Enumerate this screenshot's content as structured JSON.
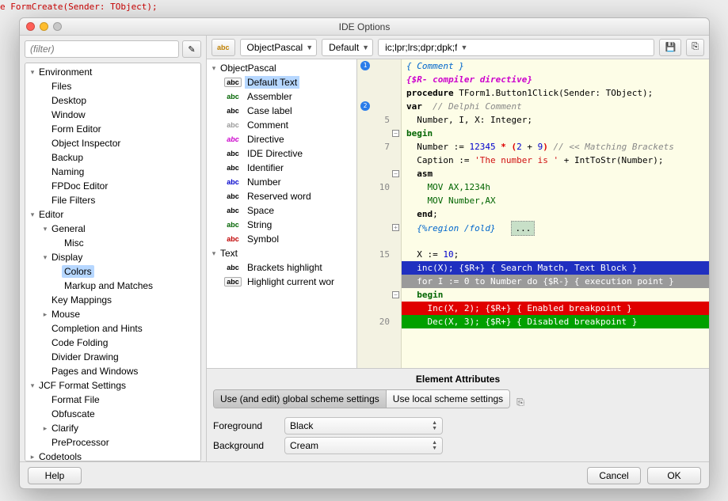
{
  "window": {
    "title": "IDE Options"
  },
  "filter": {
    "placeholder": "(filter)"
  },
  "nav": [
    {
      "label": "Environment",
      "depth": 1,
      "tw": "▾"
    },
    {
      "label": "Files",
      "depth": 2,
      "tw": ""
    },
    {
      "label": "Desktop",
      "depth": 2,
      "tw": ""
    },
    {
      "label": "Window",
      "depth": 2,
      "tw": ""
    },
    {
      "label": "Form Editor",
      "depth": 2,
      "tw": ""
    },
    {
      "label": "Object Inspector",
      "depth": 2,
      "tw": ""
    },
    {
      "label": "Backup",
      "depth": 2,
      "tw": ""
    },
    {
      "label": "Naming",
      "depth": 2,
      "tw": ""
    },
    {
      "label": "FPDoc Editor",
      "depth": 2,
      "tw": ""
    },
    {
      "label": "File Filters",
      "depth": 2,
      "tw": ""
    },
    {
      "label": "Editor",
      "depth": 1,
      "tw": "▾"
    },
    {
      "label": "General",
      "depth": 2,
      "tw": "▾"
    },
    {
      "label": "Misc",
      "depth": 3,
      "tw": ""
    },
    {
      "label": "Display",
      "depth": 2,
      "tw": "▾"
    },
    {
      "label": "Colors",
      "depth": 3,
      "tw": "",
      "sel": true
    },
    {
      "label": "Markup and Matches",
      "depth": 3,
      "tw": ""
    },
    {
      "label": "Key Mappings",
      "depth": 2,
      "tw": ""
    },
    {
      "label": "Mouse",
      "depth": 2,
      "tw": "▸"
    },
    {
      "label": "Completion and Hints",
      "depth": 2,
      "tw": ""
    },
    {
      "label": "Code Folding",
      "depth": 2,
      "tw": ""
    },
    {
      "label": "Divider Drawing",
      "depth": 2,
      "tw": ""
    },
    {
      "label": "Pages and Windows",
      "depth": 2,
      "tw": ""
    },
    {
      "label": "JCF Format Settings",
      "depth": 1,
      "tw": "▾"
    },
    {
      "label": "Format File",
      "depth": 2,
      "tw": ""
    },
    {
      "label": "Obfuscate",
      "depth": 2,
      "tw": ""
    },
    {
      "label": "Clarify",
      "depth": 2,
      "tw": "▸"
    },
    {
      "label": "PreProcessor",
      "depth": 2,
      "tw": ""
    },
    {
      "label": "Codetools",
      "depth": 1,
      "tw": "▸"
    }
  ],
  "toolbar": {
    "lang": "ObjectPascal",
    "scheme": "Default",
    "ext": "ic;lpr;lrs;dpr;dpk;f"
  },
  "elements": [
    {
      "label": "ObjectPascal",
      "depth": 0,
      "tw": "▾",
      "abc": null
    },
    {
      "label": "Default Text",
      "depth": 1,
      "abc": "abc",
      "abcColor": "#000",
      "box": true,
      "sel": true
    },
    {
      "label": "Assembler",
      "depth": 1,
      "abc": "abc",
      "abcColor": "#006400"
    },
    {
      "label": "Case label",
      "depth": 1,
      "abc": "abc",
      "abcColor": "#000"
    },
    {
      "label": "Comment",
      "depth": 1,
      "abc": "abc",
      "abcColor": "#999"
    },
    {
      "label": "Directive",
      "depth": 1,
      "abc": "abc",
      "abcColor": "#cc00cc",
      "italic": true
    },
    {
      "label": "IDE Directive",
      "depth": 1,
      "abc": "abc",
      "abcColor": "#000"
    },
    {
      "label": "Identifier",
      "depth": 1,
      "abc": "abc",
      "abcColor": "#000"
    },
    {
      "label": "Number",
      "depth": 1,
      "abc": "abc",
      "abcColor": "#0000cc"
    },
    {
      "label": "Reserved word",
      "depth": 1,
      "abc": "abc",
      "abcColor": "#000",
      "bold": true
    },
    {
      "label": "Space",
      "depth": 1,
      "abc": "abc",
      "abcColor": "#000"
    },
    {
      "label": "String",
      "depth": 1,
      "abc": "abc",
      "abcColor": "#006400"
    },
    {
      "label": "Symbol",
      "depth": 1,
      "abc": "abc",
      "abcColor": "#c00000"
    },
    {
      "label": "Text",
      "depth": 0,
      "tw": "▾",
      "abc": null
    },
    {
      "label": "Brackets highlight",
      "depth": 1,
      "abc": "abc",
      "abcColor": "#000",
      "bold": true
    },
    {
      "label": "Highlight current wor",
      "depth": 1,
      "abc": "abc",
      "abcColor": "#000",
      "box": true
    }
  ],
  "preview": {
    "gutter": [
      {
        "n": "",
        "bp": "1"
      },
      {
        "n": ""
      },
      {
        "n": ""
      },
      {
        "n": "",
        "bp": "2"
      },
      {
        "n": "5"
      },
      {
        "n": "",
        "fold": "−"
      },
      {
        "n": "7"
      },
      {
        "n": ""
      },
      {
        "n": "",
        "fold": "−"
      },
      {
        "n": "10"
      },
      {
        "n": ""
      },
      {
        "n": ""
      },
      {
        "n": "",
        "fold": "+"
      },
      {
        "n": ""
      },
      {
        "n": "15"
      },
      {
        "n": ""
      },
      {
        "n": ""
      },
      {
        "n": "",
        "fold": "−"
      },
      {
        "n": ""
      },
      {
        "n": "20"
      }
    ]
  },
  "attrs": {
    "title": "Element Attributes",
    "seg_global": "Use (and edit) global scheme settings",
    "seg_local": "Use local scheme settings",
    "fg_label": "Foreground",
    "fg_value": "Black",
    "bg_label": "Background",
    "bg_value": "Cream"
  },
  "footer": {
    "help": "Help",
    "cancel": "Cancel",
    "ok": "OK"
  }
}
